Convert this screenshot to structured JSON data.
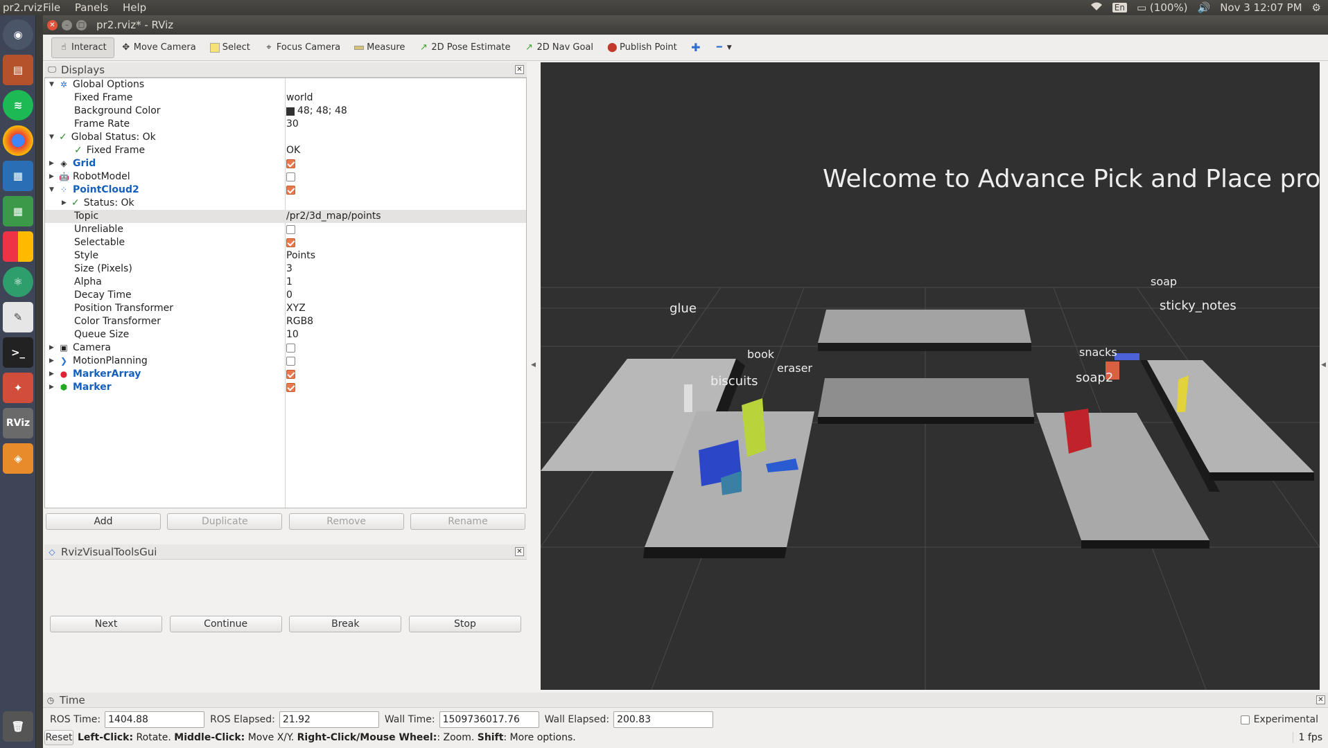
{
  "topbar": {
    "app": "pr2.rviz",
    "menus": [
      "File",
      "Panels",
      "Help"
    ],
    "lang": "En",
    "battery": "(100%)",
    "clock": "Nov 3 12:07 PM"
  },
  "window": {
    "title": "pr2.rviz* - RViz"
  },
  "toolbar": {
    "interact": "Interact",
    "move_camera": "Move Camera",
    "select": "Select",
    "focus_camera": "Focus Camera",
    "measure": "Measure",
    "pose_estimate": "2D Pose Estimate",
    "nav_goal": "2D Nav Goal",
    "publish_point": "Publish Point"
  },
  "displays": {
    "title": "Displays",
    "rows": [
      {
        "label": "Global Options",
        "value": ""
      },
      {
        "label": "Fixed Frame",
        "value": "world"
      },
      {
        "label": "Background Color",
        "value": "48; 48; 48"
      },
      {
        "label": "Frame Rate",
        "value": "30"
      },
      {
        "label": "Global Status: Ok",
        "value": ""
      },
      {
        "label": "Fixed Frame",
        "value": "OK"
      },
      {
        "label": "Grid",
        "value": ""
      },
      {
        "label": "RobotModel",
        "value": ""
      },
      {
        "label": "PointCloud2",
        "value": ""
      },
      {
        "label": "Status: Ok",
        "value": ""
      },
      {
        "label": "Topic",
        "value": "/pr2/3d_map/points"
      },
      {
        "label": "Unreliable",
        "value": ""
      },
      {
        "label": "Selectable",
        "value": ""
      },
      {
        "label": "Style",
        "value": "Points"
      },
      {
        "label": "Size (Pixels)",
        "value": "3"
      },
      {
        "label": "Alpha",
        "value": "1"
      },
      {
        "label": "Decay Time",
        "value": "0"
      },
      {
        "label": "Position Transformer",
        "value": "XYZ"
      },
      {
        "label": "Color Transformer",
        "value": "RGB8"
      },
      {
        "label": "Queue Size",
        "value": "10"
      },
      {
        "label": "Camera",
        "value": ""
      },
      {
        "label": "MotionPlanning",
        "value": ""
      },
      {
        "label": "MarkerArray",
        "value": ""
      },
      {
        "label": "Marker",
        "value": ""
      }
    ],
    "buttons": {
      "add": "Add",
      "duplicate": "Duplicate",
      "remove": "Remove",
      "rename": "Rename"
    }
  },
  "visual_tools": {
    "title": "RvizVisualToolsGui",
    "next": "Next",
    "continue": "Continue",
    "break": "Break",
    "stop": "Stop"
  },
  "scene": {
    "welcome": "Welcome  to  Advance  Pick  and  Place  project",
    "labels": {
      "soap": "soap",
      "sticky_notes": "sticky_notes",
      "glue": "glue",
      "book": "book",
      "eraser": "eraser",
      "biscuits": "biscuits",
      "snacks": "snacks",
      "soap2": "soap2"
    }
  },
  "time": {
    "title": "Time",
    "ros_time_label": "ROS Time:",
    "ros_time": "1404.88",
    "ros_elapsed_label": "ROS Elapsed:",
    "ros_elapsed": "21.92",
    "wall_time_label": "Wall Time:",
    "wall_time": "1509736017.76",
    "wall_elapsed_label": "Wall Elapsed:",
    "wall_elapsed": "200.83",
    "experimental": "Experimental"
  },
  "status": {
    "reset": "Reset",
    "l1": "Left-Click:",
    "t1": " Rotate. ",
    "l2": "Middle-Click:",
    "t2": " Move X/Y. ",
    "l3": "Right-Click/Mouse Wheel:",
    "t3": ": Zoom. ",
    "l4": "Shift",
    "t4": ": More options.",
    "fps": "1 fps"
  }
}
